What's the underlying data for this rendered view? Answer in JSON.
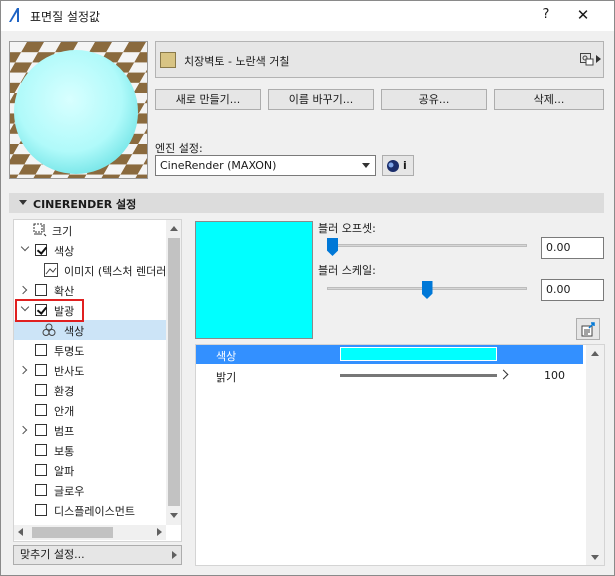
{
  "window": {
    "title": "표면질 설정값",
    "help": "?",
    "close": "✕"
  },
  "material": {
    "name": "치장벽토 - 노란색 거칠",
    "swatch_color": "#d8c484"
  },
  "buttons": {
    "new": "새로 만들기...",
    "rename": "이름 바꾸기...",
    "share": "공유...",
    "delete": "삭제..."
  },
  "engine": {
    "label": "엔진 설정:",
    "value": "CineRender (MAXON)",
    "info": "i"
  },
  "section": {
    "title": "CINERENDER 설정"
  },
  "tree": {
    "items": [
      {
        "label": "크기",
        "checkbox": null,
        "expander": null,
        "icon": "size-icon"
      },
      {
        "label": "색상",
        "checkbox": true,
        "expander": "expanded"
      },
      {
        "label": "이미지 (텍스처 렌더러",
        "checkbox": null,
        "expander": null,
        "icon": "image-icon"
      },
      {
        "label": "확산",
        "checkbox": null,
        "expander": "collapsed"
      },
      {
        "label": "발광",
        "checkbox": true,
        "expander": "expanded"
      },
      {
        "label": "색상",
        "checkbox": null,
        "expander": null,
        "icon": "color-channels-icon",
        "selected": true
      },
      {
        "label": "투명도",
        "checkbox": false,
        "expander": null
      },
      {
        "label": "반사도",
        "checkbox": false,
        "expander": "collapsed"
      },
      {
        "label": "환경",
        "checkbox": false,
        "expander": null
      },
      {
        "label": "안개",
        "checkbox": false,
        "expander": null
      },
      {
        "label": "범프",
        "checkbox": false,
        "expander": "collapsed"
      },
      {
        "label": "보통",
        "checkbox": false,
        "expander": null
      },
      {
        "label": "알파",
        "checkbox": false,
        "expander": null
      },
      {
        "label": "글로우",
        "checkbox": false,
        "expander": null
      },
      {
        "label": "디스플레이스먼트",
        "checkbox": false,
        "expander": null
      }
    ]
  },
  "fit_settings": {
    "label": "맞추기 설정..."
  },
  "emission": {
    "preview_color": "#00ffff",
    "blur_offset": {
      "label": "블러 오프셋:",
      "value": "0.00",
      "level": 0.0
    },
    "blur_scale": {
      "label": "블러 스케일:",
      "value": "0.00",
      "level": 0.5
    }
  },
  "props": {
    "rows": [
      {
        "name": "색상",
        "color": "#00ffff"
      },
      {
        "name": "밝기",
        "value": "100",
        "level": 1.0
      }
    ]
  },
  "colors": {
    "accent": "#0078d7",
    "selection": "#3390ff",
    "tree_selection": "#cce4f7",
    "highlight_box": "#e02020"
  }
}
